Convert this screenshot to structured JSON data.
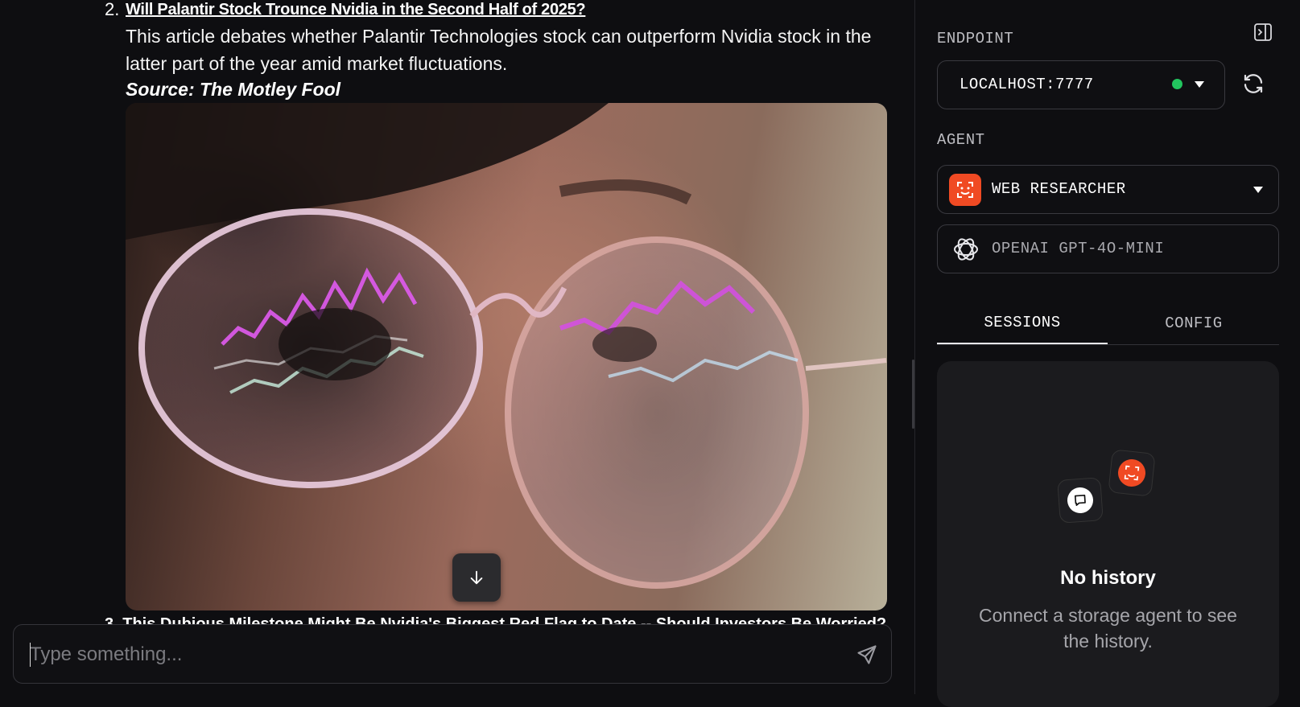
{
  "chat": {
    "item_number": "2.",
    "item_title": "Will Palantir Stock Trounce Nvidia in the Second Half of 2025?",
    "item_description": "This article debates whether Palantir Technologies stock can outperform Nvidia stock in the latter part of the year amid market fluctuations.",
    "item_source": "Source: The Motley Fool",
    "next_item_partial": "3. This Dubious Milestone Might Be Nvidia's Biggest Red Flag to Date -- Should Investors Be Worried?",
    "image_icon": "photo-glasses-stock-chart",
    "scroll_icon": "arrow-down-icon",
    "input_placeholder": "Type something...",
    "send_icon": "send-icon"
  },
  "sidebar": {
    "endpoint_label": "ENDPOINT",
    "endpoint_value": "LOCALHOST:7777",
    "endpoint_status_color": "#22c55e",
    "agent_label": "AGENT",
    "agent_name": "WEB RESEARCHER",
    "agent_icon_color": "#f04a23",
    "model_name": "OPENAI GPT-4O-MINI",
    "tabs": [
      {
        "label": "SESSIONS",
        "active": true
      },
      {
        "label": "CONFIG",
        "active": false
      }
    ],
    "empty_title": "No history",
    "empty_description": "Connect a storage agent to see the history."
  }
}
